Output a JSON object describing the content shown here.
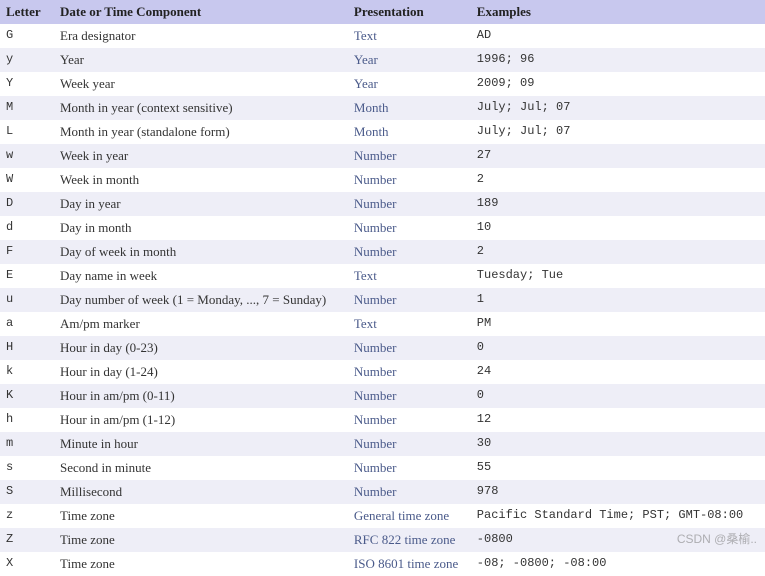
{
  "headers": {
    "letter": "Letter",
    "component": "Date or Time Component",
    "presentation": "Presentation",
    "examples": "Examples"
  },
  "rows": [
    {
      "letter": "G",
      "component": "Era designator",
      "presentation": "Text",
      "examples": "AD"
    },
    {
      "letter": "y",
      "component": "Year",
      "presentation": "Year",
      "examples": "1996; 96"
    },
    {
      "letter": "Y",
      "component": "Week year",
      "presentation": "Year",
      "examples": "2009; 09"
    },
    {
      "letter": "M",
      "component": "Month in year (context sensitive)",
      "presentation": "Month",
      "examples": "July; Jul; 07"
    },
    {
      "letter": "L",
      "component": "Month in year (standalone form)",
      "presentation": "Month",
      "examples": "July; Jul; 07"
    },
    {
      "letter": "w",
      "component": "Week in year",
      "presentation": "Number",
      "examples": "27"
    },
    {
      "letter": "W",
      "component": "Week in month",
      "presentation": "Number",
      "examples": "2"
    },
    {
      "letter": "D",
      "component": "Day in year",
      "presentation": "Number",
      "examples": "189"
    },
    {
      "letter": "d",
      "component": "Day in month",
      "presentation": "Number",
      "examples": "10"
    },
    {
      "letter": "F",
      "component": "Day of week in month",
      "presentation": "Number",
      "examples": "2"
    },
    {
      "letter": "E",
      "component": "Day name in week",
      "presentation": "Text",
      "examples": "Tuesday; Tue"
    },
    {
      "letter": "u",
      "component": "Day number of week (1 = Monday, ..., 7 = Sunday)",
      "presentation": "Number",
      "examples": "1"
    },
    {
      "letter": "a",
      "component": "Am/pm marker",
      "presentation": "Text",
      "examples": "PM"
    },
    {
      "letter": "H",
      "component": "Hour in day (0-23)",
      "presentation": "Number",
      "examples": "0"
    },
    {
      "letter": "k",
      "component": "Hour in day (1-24)",
      "presentation": "Number",
      "examples": "24"
    },
    {
      "letter": "K",
      "component": "Hour in am/pm (0-11)",
      "presentation": "Number",
      "examples": "0"
    },
    {
      "letter": "h",
      "component": "Hour in am/pm (1-12)",
      "presentation": "Number",
      "examples": "12"
    },
    {
      "letter": "m",
      "component": "Minute in hour",
      "presentation": "Number",
      "examples": "30"
    },
    {
      "letter": "s",
      "component": "Second in minute",
      "presentation": "Number",
      "examples": "55"
    },
    {
      "letter": "S",
      "component": "Millisecond",
      "presentation": "Number",
      "examples": "978"
    },
    {
      "letter": "z",
      "component": "Time zone",
      "presentation": "General time zone",
      "examples": "Pacific Standard Time; PST; GMT-08:00"
    },
    {
      "letter": "Z",
      "component": "Time zone",
      "presentation": "RFC 822 time zone",
      "examples": "-0800"
    },
    {
      "letter": "X",
      "component": "Time zone",
      "presentation": "ISO 8601 time zone",
      "examples": "-08; -0800; -08:00"
    }
  ],
  "watermark": "CSDN @桑榆.."
}
